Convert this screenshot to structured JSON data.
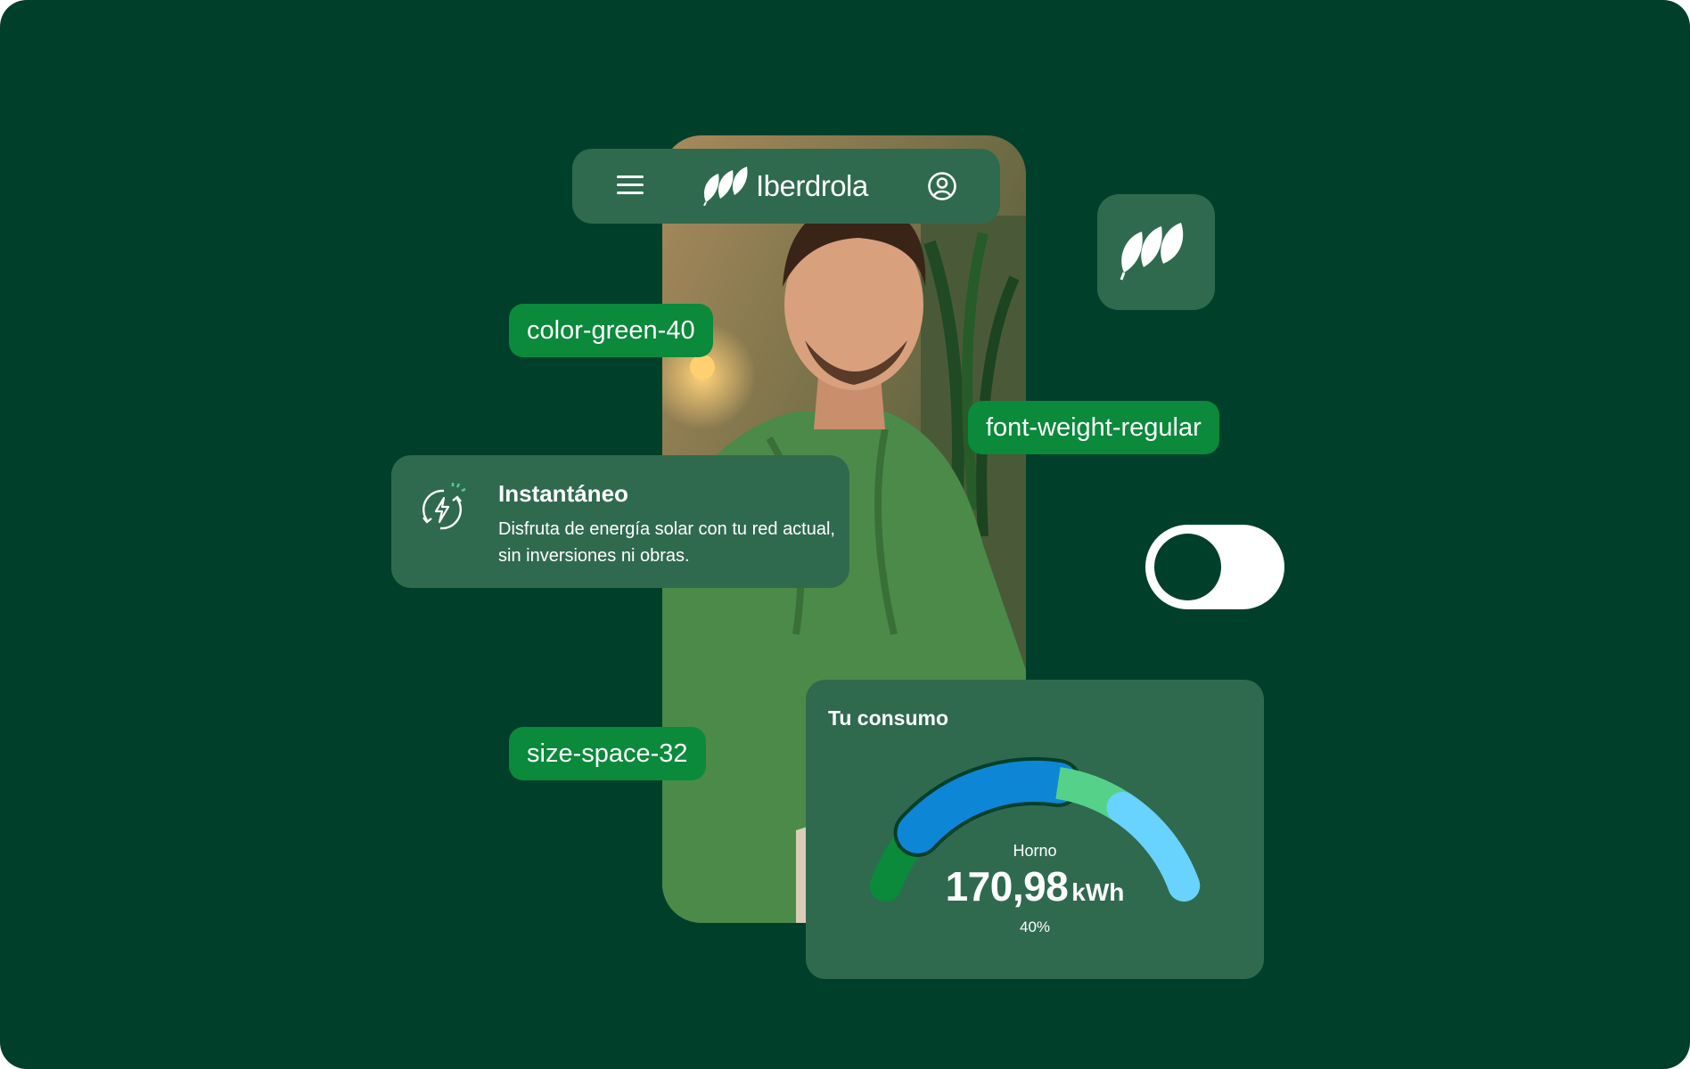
{
  "topbar": {
    "brand_name": "Iberdrola"
  },
  "tokens": {
    "color_token": "color-green-40",
    "font_token": "font-weight-regular",
    "space_token": "size-space-32"
  },
  "info_card": {
    "title": "Instantáneo",
    "description": "Disfruta de energía solar con tu red actual, sin inversiones ni obras.",
    "icon": "solar-lightning-refresh-icon"
  },
  "toggle": {
    "state": "off"
  },
  "consumo": {
    "title": "Tu consumo",
    "device": "Horno",
    "value": "170,98",
    "unit": "kWh",
    "percent_label": "40%",
    "percent": 40,
    "segments": [
      {
        "color": "#0a8a3a",
        "share": 0.16
      },
      {
        "color": "#0e86d6",
        "share": 0.4
      },
      {
        "color": "#55d18a",
        "share": 0.18
      },
      {
        "color": "#68d3ff",
        "share": 0.26
      }
    ]
  },
  "icons": {
    "menu": "hamburger-menu-icon",
    "user": "user-profile-icon",
    "logo": "iberdrola-leaves-logo"
  },
  "colors": {
    "background": "#00402b",
    "surface": "#2f6a4f",
    "chip": "#0a8a3a",
    "white": "#ffffff"
  }
}
